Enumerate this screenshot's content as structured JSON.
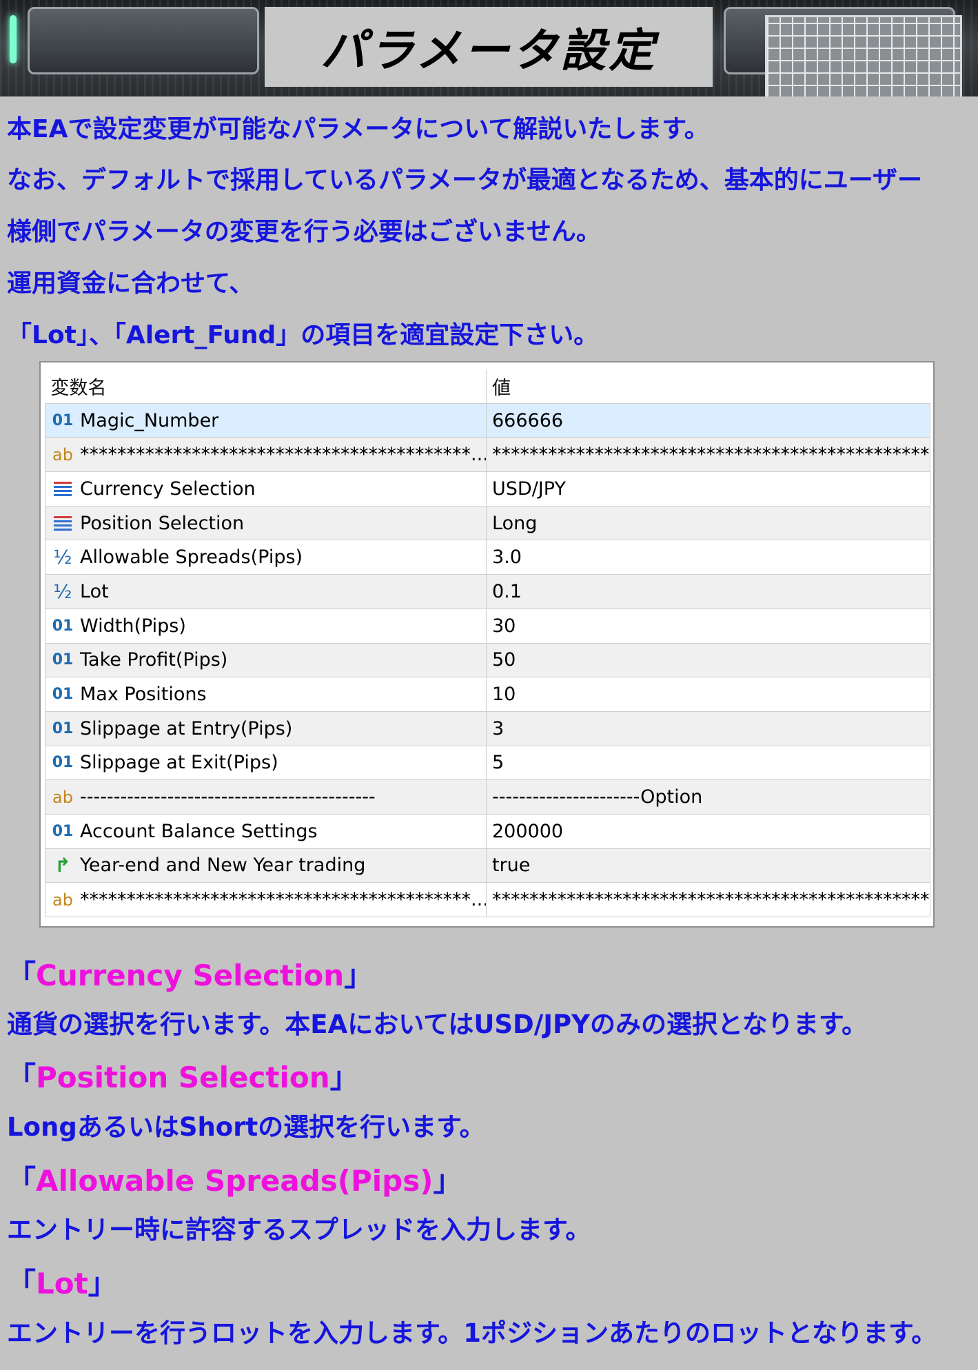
{
  "banner": {
    "title": "パラメータ設定"
  },
  "intro": {
    "lines": [
      "本EAで設定変更が可能なパラメータについて解説いたします。",
      "なお、デフォルトで採用しているパラメータが最適となるため、基本的にユーザー",
      "様側でパラメータの変更を行う必要はございません。",
      "運用資金に合わせて、",
      "「Lot」、「Alert_Fund」の項目を適宜設定下さい。"
    ]
  },
  "table": {
    "header": {
      "name": "変数名",
      "value": "値"
    },
    "rows": [
      {
        "icon": "int-icon",
        "name": "Magic_Number",
        "value": "666666"
      },
      {
        "icon": "string-icon",
        "name": "******************************************...",
        "value": "***********************************************..."
      },
      {
        "icon": "enum-icon",
        "name": "Currency Selection",
        "value": "USD/JPY"
      },
      {
        "icon": "enum-icon",
        "name": "Position Selection",
        "value": "Long"
      },
      {
        "icon": "double-icon",
        "name": "Allowable Spreads(Pips)",
        "value": "3.0"
      },
      {
        "icon": "double-icon",
        "name": "Lot",
        "value": "0.1"
      },
      {
        "icon": "int-icon",
        "name": "Width(Pips)",
        "value": "30"
      },
      {
        "icon": "int-icon",
        "name": "Take Profit(Pips)",
        "value": "50"
      },
      {
        "icon": "int-icon",
        "name": "Max Positions",
        "value": "10"
      },
      {
        "icon": "int-icon",
        "name": "Slippage at Entry(Pips)",
        "value": "3"
      },
      {
        "icon": "int-icon",
        "name": "Slippage at Exit(Pips)",
        "value": "5"
      },
      {
        "icon": "string-icon",
        "name": "--------------------------------------------",
        "value": "----------------------Option"
      },
      {
        "icon": "int-icon",
        "name": "Account Balance Settings",
        "value": "200000"
      },
      {
        "icon": "bool-icon",
        "name": "Year-end and New Year trading",
        "value": "true"
      },
      {
        "icon": "string-icon",
        "name": "******************************************...",
        "value": "***********************************************..."
      }
    ],
    "icon_glyphs": {
      "int": "01",
      "string": "ab",
      "double": "½",
      "bool": "↱"
    },
    "colors": {
      "selected_row": "#dbeeff",
      "alt_row": "#f0f0f0",
      "enum_top": "#d23a3a",
      "enum_lines": "#2a6fd0"
    }
  },
  "descriptions": [
    {
      "open": "「",
      "title": "Currency Selection",
      "close": "」",
      "body": "通貨の選択を行います。本EAにおいてはUSD/JPYのみの選択となります。"
    },
    {
      "open": "「",
      "title": "Position Selection",
      "close": "」",
      "body": "LongあるいはShortの選択を行います。"
    },
    {
      "open": "「",
      "title": "Allowable Spreads(Pips)",
      "close": "」",
      "body": "エントリー時に許容するスプレッドを入力します。"
    },
    {
      "open": "「",
      "title": "Lot",
      "close": "」",
      "body": "エントリーを行うロットを入力します。1ポジションあたりのロットとなります。"
    }
  ],
  "colors": {
    "page_bg": "#c3c3c3",
    "text_blue": "#1515dd",
    "title_magenta": "#ee11dd"
  }
}
